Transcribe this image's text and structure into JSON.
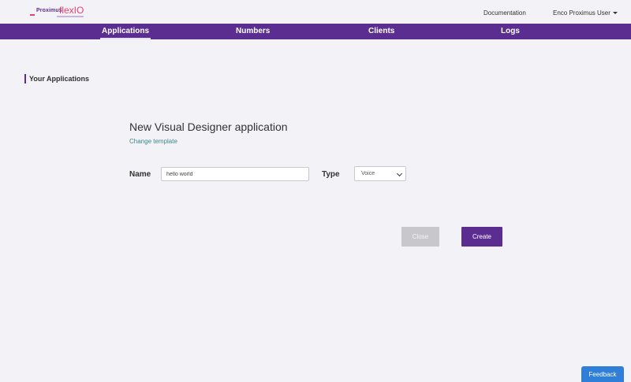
{
  "header": {
    "logo": {
      "brand": "Proximus",
      "product": "flexIO"
    },
    "documentation_label": "Documentation",
    "user_label": "Enco Proximus User"
  },
  "nav": {
    "items": [
      {
        "label": "Applications",
        "active": true
      },
      {
        "label": "Numbers",
        "active": false
      },
      {
        "label": "Clients",
        "active": false
      },
      {
        "label": "Logs",
        "active": false
      }
    ]
  },
  "page": {
    "section_title": "Your Applications",
    "form_title": "New Visual Designer application",
    "change_template_label": "Change template",
    "name_label": "Name",
    "name_value": "hello world",
    "type_label": "Type",
    "type_value": "Voice",
    "close_label": "Close",
    "create_label": "Create"
  },
  "feedback_label": "Feedback",
  "colors": {
    "brand_purple": "#5c2d91",
    "logo_pink": "#e5426e",
    "link_teal": "#3a8a8a",
    "feedback_blue": "#2f7fd8"
  }
}
